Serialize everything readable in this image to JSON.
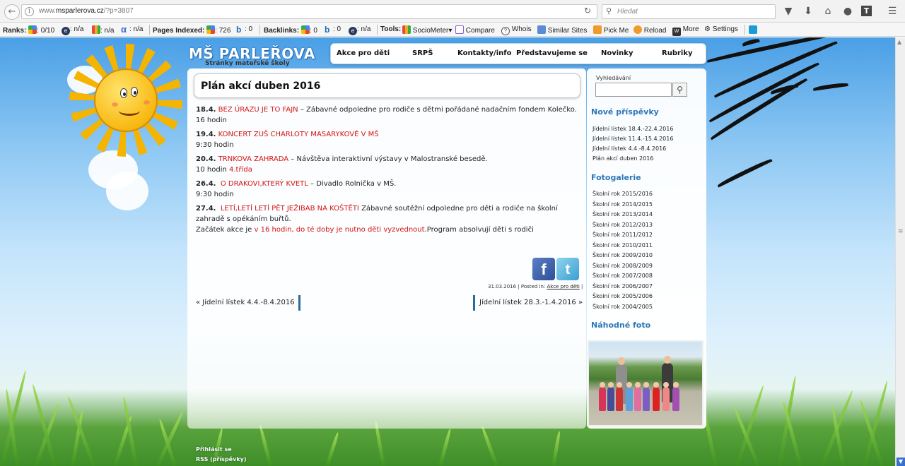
{
  "browser": {
    "url_prefix": "www.",
    "url_domain": "msparlerova.cz",
    "url_path": "/?p=3807",
    "search_placeholder": "Hledat"
  },
  "seobar": {
    "ranks_label": "Ranks:",
    "google_rank": ": 0/10",
    "rank2": ": n/a",
    "rank3": ": n/a",
    "alexa": ": n/a",
    "pages_indexed_label": "Pages Indexed:",
    "pages_google": ": 726",
    "pages_bing": ": 0",
    "backlinks_label": "Backlinks:",
    "back_google": ": 0",
    "back_bing": ": 0",
    "back_3": ": n/a",
    "tools_label": "Tools:",
    "sociometer": "SocioMeter",
    "compare": "Compare",
    "whois": "Whois",
    "similar": "Similar Sites",
    "pickme": "Pick Me",
    "reload": "Reload",
    "more": "More",
    "settings": "Settings"
  },
  "site": {
    "title": "MŠ PARLEŘOVA",
    "subtitle": "Stránky mateřské školy"
  },
  "menu": [
    "Akce pro děti",
    "SRPŠ",
    "Kontakty/info",
    "Představujeme se",
    "Novinky",
    "Rubriky"
  ],
  "post": {
    "title": "Plán akcí duben 2016",
    "e1_date": "18.4.",
    "e1_name": "BEZ ÚRAZU JE TO FAJN",
    "e1_desc": " – Zábavné odpoledne pro rodiče s dětmi pořádané nadačním fondem Kolečko.",
    "e1_time": "16 hodin",
    "e2_date": "19.4.",
    "e2_name": "KONCERT ZUŠ CHARLOTY MASARYKOVÉ V MŠ",
    "e2_time": "9:30 hodin",
    "e3_date": "20.4.",
    "e3_name": "TRNKOVA ZAHRADA",
    "e3_desc": " – Návštěva interaktivní výstavy v Malostranské besedě.",
    "e3_time": "10 hodin ",
    "e3_class": "4.třída",
    "e4_date": "26.4.",
    "e4_name": "O DRAKOVI,KTERÝ KVETL",
    "e4_desc": " – Divadlo Rolnička v MŠ.",
    "e4_time": "9:30 hodin",
    "e5_date": "27.4.",
    "e5_name": "LETÍ,LETÍ LETÍ PĚT JEŽIBAB NA KOŠTĚTI",
    "e5_desc1": "  Zábavné soutěžní odpoledne pro děti a rodiče na školní",
    "e5_desc2": "zahradě s opékáním buřtů.",
    "e5_start": "Začátek akce je ",
    "e5_red": "v 16 hodin, do té doby je nutno děti vyzvednout",
    "e5_end": ".Program absolvují děti s rodiči",
    "meta_date": "31.03.2016 | Posted in: ",
    "meta_cat": "Akce pro děti",
    "meta_end": " |",
    "prev": "« Jídelní lístek 4.4.-8.4.2016",
    "next": "Jídelní lístek 28.3.-1.4.2016 »",
    "fb": "f",
    "tw": "t"
  },
  "sidebar": {
    "search_label": "Vyhledávání",
    "new_posts_title": "Nové příspěvky",
    "new_posts": [
      "Jídelní lístek 18.4.-22.4.2016",
      "Jídelní lístek 11.4.-15.4.2016",
      "Jídelní lístek 4.4.-8.4.2016",
      "Plán akcí duben 2016"
    ],
    "gallery_title": "Fotogalerie",
    "gallery": [
      "Školní rok 2015/2016",
      "Školní rok 2014/2015",
      "Školní rok 2013/2014",
      "Školní rok 2012/2013",
      "Školní rok 2011/2012",
      "Školní rok 2010/2011",
      "Školní rok 2009/2010",
      "Školní rok 2008/2009",
      "Školní rok 2007/2008",
      "Školní rok 2006/2007",
      "Školní rok 2005/2006",
      "Školní rok 2004/2005"
    ],
    "random_photo_title": "Náhodné foto"
  },
  "footer": {
    "login": "Přihlásit se",
    "rss": "RSS (příspěvky)"
  },
  "colors": {
    "accent_blue": "#2e77b8",
    "event_red": "#d51414"
  }
}
